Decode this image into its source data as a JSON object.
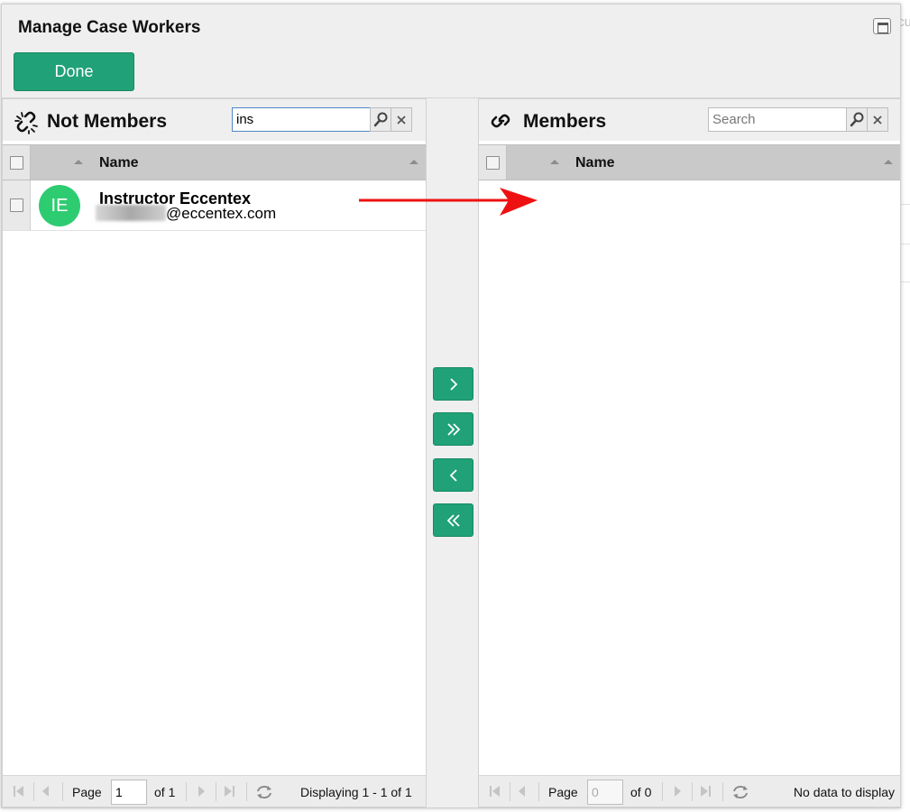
{
  "dialog": {
    "title": "Manage Case Workers",
    "done_label": "Done",
    "window_icon": "window-restore-icon"
  },
  "left_panel": {
    "title": "Not Members",
    "icon": "unlink-icon",
    "search_value": "ins",
    "column_header": "Name",
    "rows": [
      {
        "initials": "IE",
        "avatar_color": "#2ecc71",
        "name": "Instructor Eccentex",
        "email_visible": "@eccentex.com"
      }
    ],
    "pager": {
      "page_label": "Page",
      "page_value": "1",
      "of_label": "of 1",
      "status": "Displaying 1 - 1 of 1"
    }
  },
  "right_panel": {
    "title": "Members",
    "icon": "link-icon",
    "search_placeholder": "Search",
    "column_header": "Name",
    "pager": {
      "page_label": "Page",
      "page_value": "0",
      "of_label": "of 0",
      "status": "No data to display"
    }
  },
  "move_buttons": [
    "move-selected-right",
    "move-all-right",
    "move-selected-left",
    "move-all-left"
  ],
  "colors": {
    "accent_green": "#21a178",
    "annotation_red": "#ee1111"
  },
  "background_text": "cu"
}
